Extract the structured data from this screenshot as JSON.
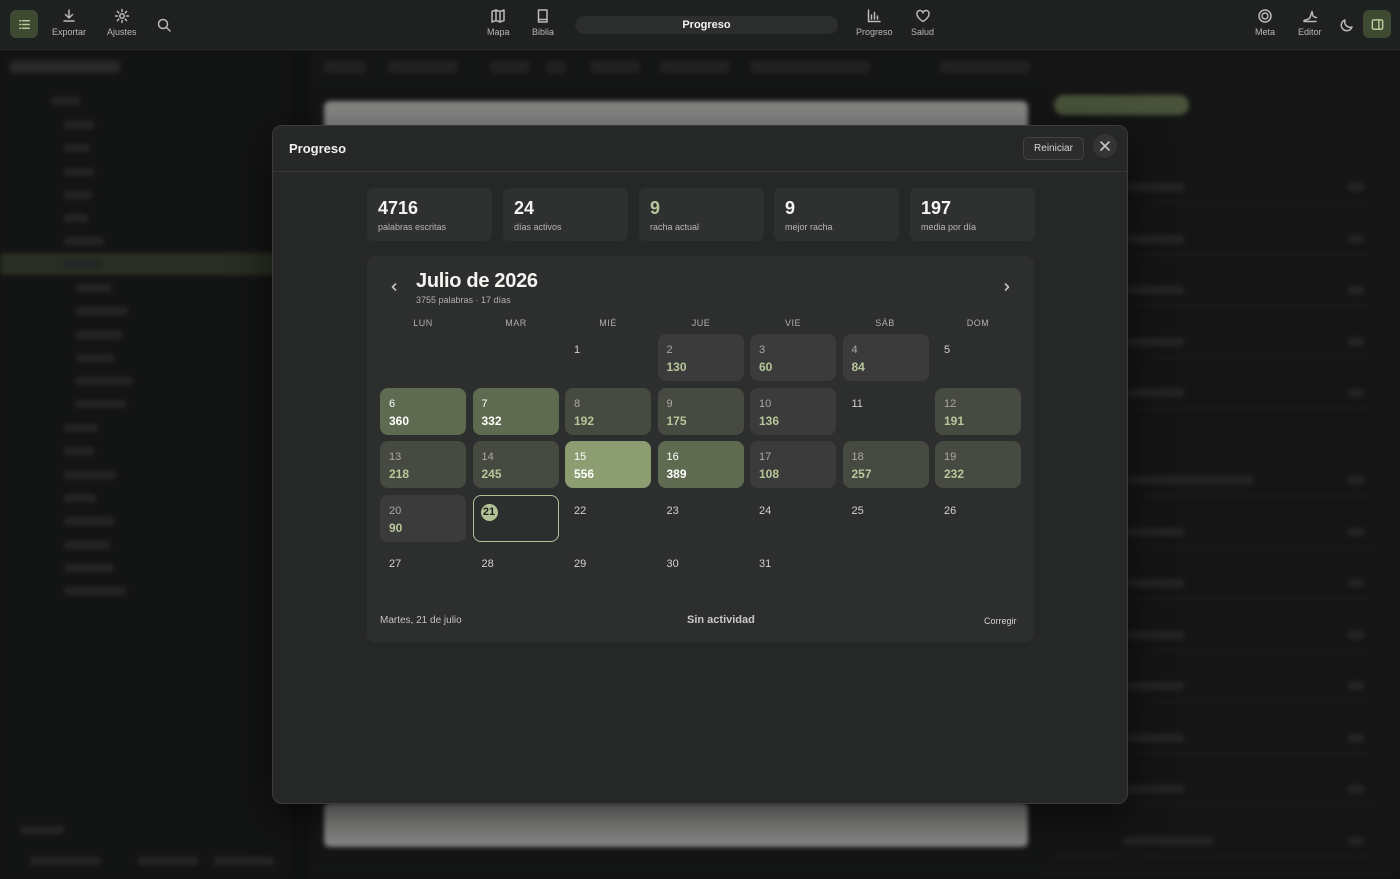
{
  "toolbar": {
    "export_label": "Exportar",
    "settings_label": "Ajustes",
    "map_label": "Mapa",
    "bible_label": "Biblia",
    "current_view": "Progreso",
    "progress_label": "Progreso",
    "health_label": "Salud",
    "goal_label": "Meta",
    "editor_label": "Editor",
    "accent_color": "#6b7b55"
  },
  "modal": {
    "title": "Progreso",
    "reset_label": "Reiniciar",
    "stats": [
      {
        "value": "4716",
        "label": "palabras escritas"
      },
      {
        "value": "24",
        "label": "días activos"
      },
      {
        "value": "9",
        "label": "racha actual"
      },
      {
        "value": "9",
        "label": "mejor racha"
      },
      {
        "value": "197",
        "label": "media por día"
      }
    ],
    "calendar": {
      "title": "Julio de 2026",
      "subtitle": "3755 palabras · 17 días",
      "weekdays": [
        "LUN",
        "MAR",
        "MIÉ",
        "JUE",
        "VIE",
        "SÁB",
        "DOM"
      ],
      "days": [
        {
          "day": "1",
          "words": ""
        },
        {
          "day": "2",
          "words": "130"
        },
        {
          "day": "3",
          "words": "60"
        },
        {
          "day": "4",
          "words": "84"
        },
        {
          "day": "5",
          "words": ""
        },
        {
          "day": "6",
          "words": "360"
        },
        {
          "day": "7",
          "words": "332"
        },
        {
          "day": "8",
          "words": "192"
        },
        {
          "day": "9",
          "words": "175"
        },
        {
          "day": "10",
          "words": "136"
        },
        {
          "day": "11",
          "words": ""
        },
        {
          "day": "12",
          "words": "191"
        },
        {
          "day": "13",
          "words": "218"
        },
        {
          "day": "14",
          "words": "245"
        },
        {
          "day": "15",
          "words": "556"
        },
        {
          "day": "16",
          "words": "389"
        },
        {
          "day": "17",
          "words": "108"
        },
        {
          "day": "18",
          "words": "257"
        },
        {
          "day": "19",
          "words": "232"
        },
        {
          "day": "20",
          "words": "90"
        },
        {
          "day": "21",
          "words": "",
          "today": true
        },
        {
          "day": "22",
          "words": ""
        },
        {
          "day": "23",
          "words": ""
        },
        {
          "day": "24",
          "words": ""
        },
        {
          "day": "25",
          "words": ""
        },
        {
          "day": "26",
          "words": ""
        },
        {
          "day": "27",
          "words": ""
        },
        {
          "day": "28",
          "words": ""
        },
        {
          "day": "29",
          "words": ""
        },
        {
          "day": "30",
          "words": ""
        },
        {
          "day": "31",
          "words": ""
        }
      ]
    },
    "footer": {
      "selected_date": "Martes, 21 de julio",
      "status": "Sin actividad",
      "fix_label": "Corregir"
    }
  }
}
